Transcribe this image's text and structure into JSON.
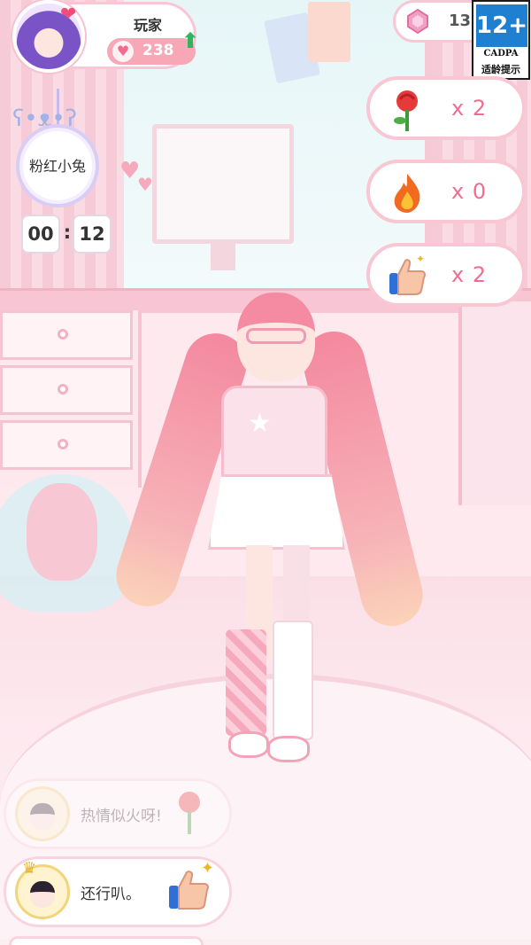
{
  "player": {
    "name": "玩家",
    "love_points": "238"
  },
  "currency": {
    "gems": "13"
  },
  "age_rating": {
    "rating": "12+",
    "organization": "CADPA",
    "tip": "适龄提示"
  },
  "theme": {
    "label": "粉红小兔"
  },
  "timer": {
    "minutes": "00",
    "separator": ":",
    "seconds": "12"
  },
  "reactions": [
    {
      "icon": "rose-icon",
      "count": "x 2"
    },
    {
      "icon": "fire-icon",
      "count": "x 0"
    },
    {
      "icon": "thumbs-up-icon",
      "count": "x 2"
    }
  ],
  "chat": [
    {
      "text": "热情似火呀!",
      "faded": true
    },
    {
      "text": "还行叭。",
      "faded": false
    }
  ],
  "colors": {
    "accent_pink": "#f9c6d3",
    "count_pink": "#f06d8f",
    "love_pill": "#f7a7b5",
    "badge_blue": "#1f7fd0"
  }
}
